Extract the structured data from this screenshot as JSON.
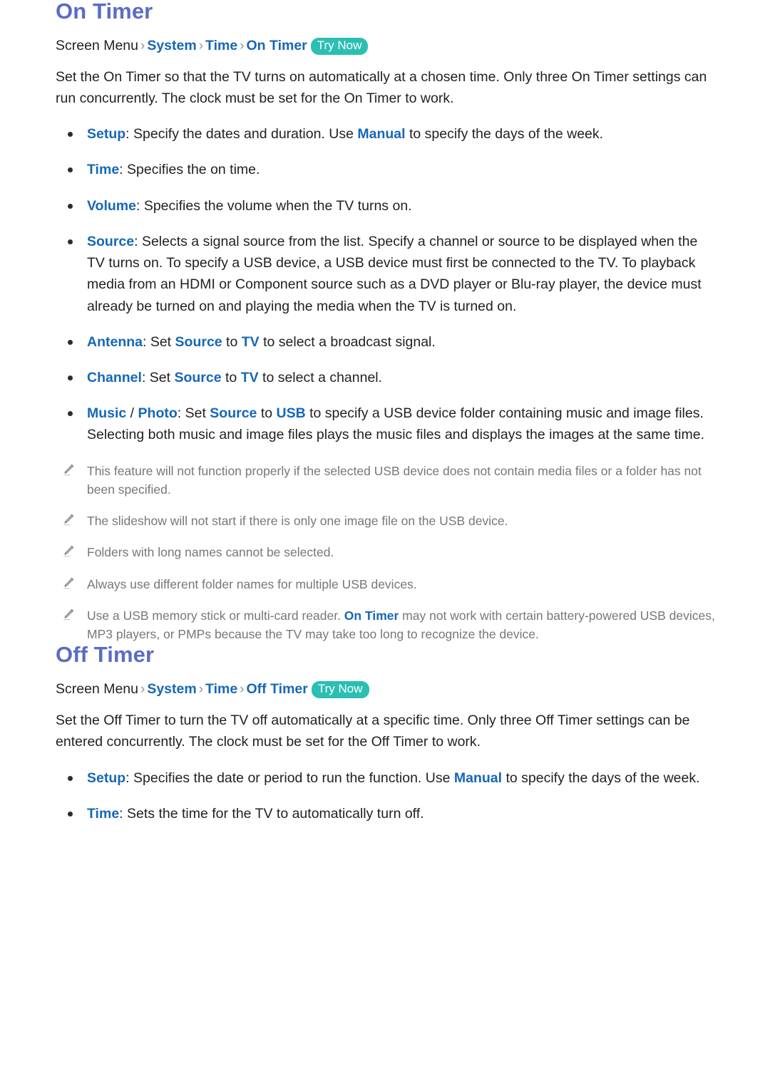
{
  "document": {
    "colors": {
      "heading": "#5B6CC4",
      "keyword_blue": "#1667B8",
      "body_text": "#231F20",
      "note_text": "#77777C",
      "try_now_badge": "#2BBFB3",
      "background": "#FFFFFF"
    },
    "sections": [
      {
        "id": "on-timer",
        "title": "On Timer",
        "breadcrumb": {
          "root": "Screen Menu",
          "separator": "›",
          "links": [
            "System",
            "Time",
            "On Timer"
          ],
          "badge": "Try Now"
        },
        "intro": "Set the On Timer so that the TV turns on automatically at a chosen time. Only three On Timer settings can run concurrently. The clock must be set for the On Timer to work.",
        "bullets": [
          {
            "id": "setup",
            "label": "Setup",
            "text_1": ": Specify the dates and duration. Use ",
            "kw_1": "Manual",
            "text_2": " to specify the days of the week."
          },
          {
            "id": "time",
            "label": "Time",
            "text_1": ": Specifies the on time."
          },
          {
            "id": "volume",
            "label": "Volume",
            "text_1": ": Specifies the volume when the TV turns on."
          },
          {
            "id": "source",
            "label": "Source",
            "text_1": ": Selects a signal source from the list. Specify a channel or source to be displayed when the TV turns on. To specify a USB device, a USB device must first be connected to the TV. To playback media from an HDMI or Component source such as a DVD player or Blu-ray player, the device must already be turned on and playing the media when the TV is turned on."
          },
          {
            "id": "antenna",
            "label": "Antenna",
            "text_1": ": Set ",
            "kw_1": "Source",
            "text_2": " to ",
            "kw_2": "TV",
            "text_3": " to select a broadcast signal."
          },
          {
            "id": "channel",
            "label": "Channel",
            "text_1": ": Set ",
            "kw_1": "Source",
            "text_2": " to ",
            "kw_2": "TV",
            "text_3": " to select a channel."
          },
          {
            "id": "music-photo",
            "label": "Music",
            "label_sep": " / ",
            "label_2": "Photo",
            "text_1": ": Set ",
            "kw_1": "Source",
            "text_2": " to ",
            "kw_2": "USB",
            "text_3": " to specify a USB device folder containing music and image files. Selecting both music and image files plays the music files and displays the images at the same time."
          }
        ],
        "notes": [
          {
            "id": "note-media-files",
            "icon": "pencil-icon",
            "text": "This feature will not function properly if the selected USB device does not contain media files or a folder has not been specified."
          },
          {
            "id": "note-slideshow",
            "icon": "pencil-icon",
            "text": "The slideshow will not start if there is only one image file on the USB device."
          },
          {
            "id": "note-long-names",
            "icon": "pencil-icon",
            "text": "Folders with long names cannot be selected."
          },
          {
            "id": "note-different-names",
            "icon": "pencil-icon",
            "text": "Always use different folder names for multiple USB devices."
          },
          {
            "id": "note-usb-stick",
            "icon": "pencil-icon",
            "text_1": "Use a USB memory stick or multi-card reader. ",
            "kw_1": "On Timer",
            "text_2": " may not work with certain battery-powered USB devices, MP3 players, or PMPs because the TV may take too long to recognize the device."
          }
        ]
      },
      {
        "id": "off-timer",
        "title": "Off Timer",
        "breadcrumb": {
          "root": "Screen Menu",
          "separator": "›",
          "links": [
            "System",
            "Time",
            "Off Timer"
          ],
          "badge": "Try Now"
        },
        "intro": "Set the Off Timer to turn the TV off automatically at a specific time. Only three Off Timer settings can be entered concurrently. The clock must be set for the Off Timer to work.",
        "bullets": [
          {
            "id": "setup",
            "label": "Setup",
            "text_1": ": Specifies the date or period to run the function. Use ",
            "kw_1": "Manual",
            "text_2": " to specify the days of the week."
          },
          {
            "id": "time",
            "label": "Time",
            "text_1": ": Sets the time for the TV to automatically turn off."
          }
        ]
      }
    ]
  }
}
